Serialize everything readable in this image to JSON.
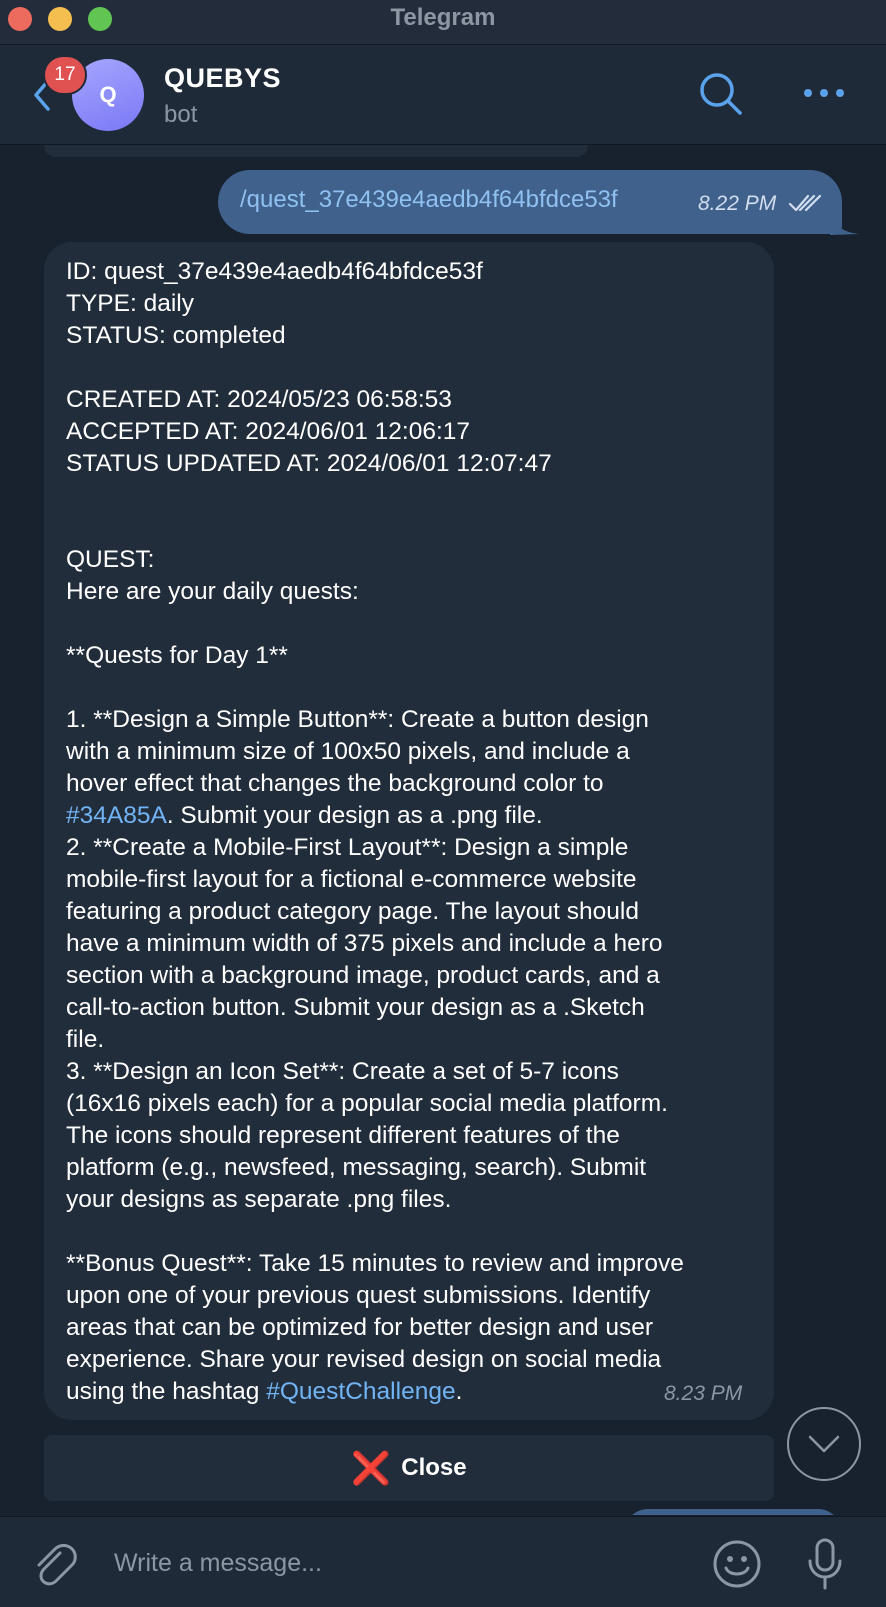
{
  "window": {
    "title": "Telegram"
  },
  "header": {
    "unread_count": "17",
    "avatar_letter": "Q",
    "chat_name": "QUEBYS",
    "chat_subtitle": "bot"
  },
  "messages": {
    "outgoing": {
      "text": "/quest_37e439e4aedb4f64bfdce53f",
      "time": "8.22 PM"
    },
    "incoming": {
      "lines": [
        "ID: quest_37e439e4aedb4f64bfdce53f",
        "TYPE: daily",
        "STATUS: completed",
        "",
        "CREATED AT: 2024/05/23 06:58:53",
        "ACCEPTED AT: 2024/06/01 12:06:17",
        "STATUS UPDATED AT: 2024/06/01 12:07:47",
        "",
        "",
        "QUEST:",
        "Here are your daily quests:",
        "",
        "**Quests for Day 1**",
        "",
        "1. **Design a Simple Button**: Create a button design",
        "with a minimum size of 100x50 pixels, and include a",
        "hover effect that changes the background color to",
        "2. **Create a Mobile-First Layout**: Design a simple",
        "mobile-first layout for a fictional e-commerce website",
        "featuring a product category page. The layout should",
        "have a minimum width of 375 pixels and include a hero",
        "section with a background image, product cards, and a",
        "call-to-action button. Submit your design as a .Sketch",
        "file.",
        "3. **Design an Icon Set**: Create a set of 5-7 icons",
        "(16x16 pixels each) for a popular social media platform.",
        "The icons should represent different features of the",
        "platform (e.g., newsfeed, messaging, search). Submit",
        "your designs as separate .png files.",
        "",
        "**Bonus Quest**: Take 15 minutes to review and improve",
        "upon one of your previous quest submissions. Identify",
        "areas that can be optimized for better design and user",
        "experience. Share your revised design on social media"
      ],
      "color_link": "#34A85A",
      "color_suffix": ". Submit your design as a .png file.",
      "last_line_prefix": "using the hashtag ",
      "hashtag": "#QuestChallenge",
      "last_line_suffix": ".",
      "time": "8.23 PM"
    }
  },
  "keyboard": {
    "close_emoji": "❌",
    "close_label": "Close"
  },
  "composer": {
    "placeholder": "Write a message..."
  },
  "colors": {
    "background": "#18212e",
    "bubble_in": "#222d3b",
    "bubble_out": "#3f618c",
    "link": "#71b4f5",
    "badge": "#e05151"
  }
}
